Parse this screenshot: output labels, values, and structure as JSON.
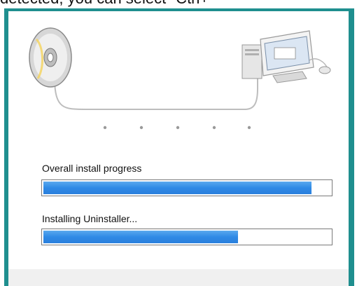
{
  "header": {
    "caption": "detected, you can select \"Ctrl+"
  },
  "install": {
    "overall_label": "Overall install progress",
    "overall_progress": 0.935,
    "current_label": "Installing Uninstaller...",
    "current_progress": 0.68
  },
  "illustration": {
    "icons": [
      "disc-icon",
      "computer-icon",
      "mouse-icon"
    ],
    "dot_count": 5
  },
  "colors": {
    "frame": "#1f8f8f",
    "progress_fill": "#2f8ae6",
    "background": "#ffffff"
  }
}
